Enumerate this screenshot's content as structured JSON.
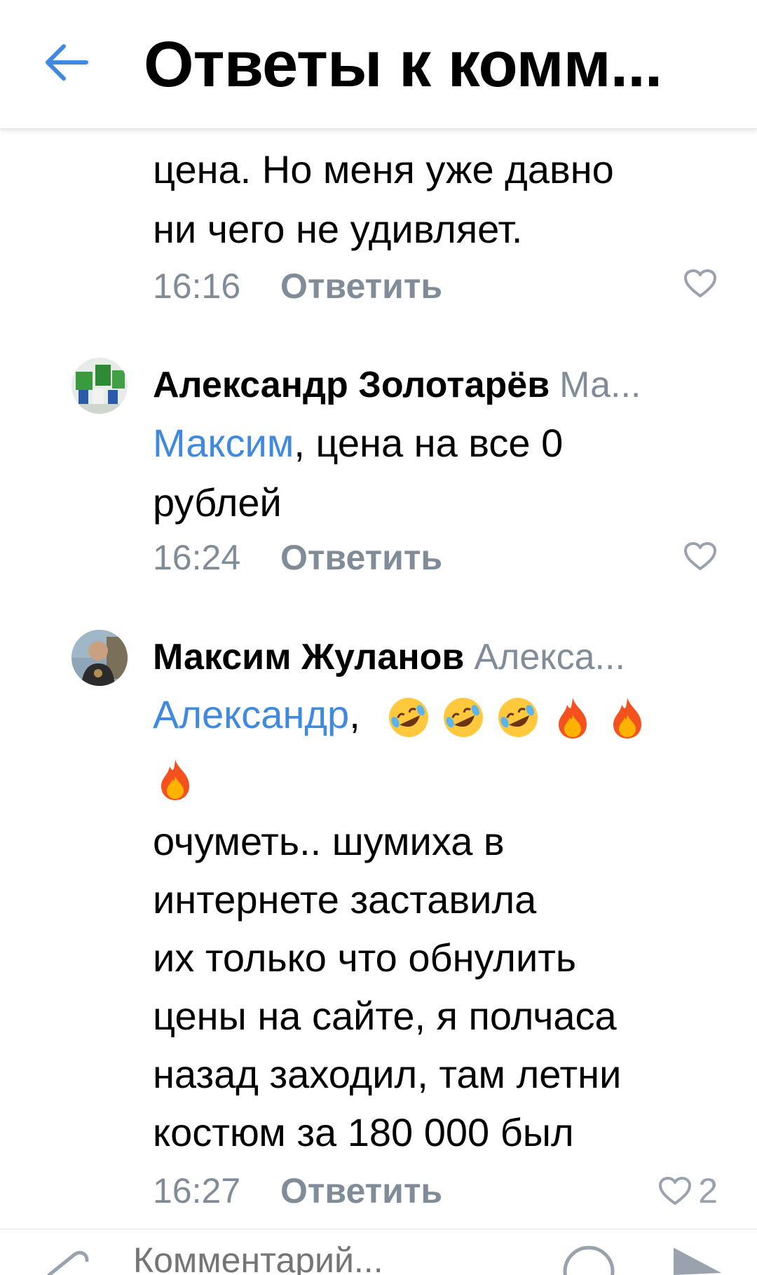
{
  "header": {
    "title": "Ответы к комм..."
  },
  "comments": [
    {
      "text_lines": [
        "цена. Но меня уже давно",
        "ни чего не удивляет."
      ],
      "time": "16:16",
      "reply_label": "Ответить"
    },
    {
      "author": "Александр Золотарёв",
      "reply_to": "Ма...",
      "mention": "Максим",
      "text_after_mention": ", цена на все 0",
      "text_lines": [
        "рублей"
      ],
      "time": "16:24",
      "reply_label": "Ответить"
    },
    {
      "author": "Максим Жуланов",
      "reply_to": "Алекса...",
      "mention": "Александр",
      "text_after_mention": ",",
      "emojis": [
        "rolling-laughing-emoji",
        "rolling-laughing-emoji",
        "rolling-laughing-emoji",
        "fire-emoji",
        "fire-emoji",
        "fire-emoji"
      ],
      "text_lines": [
        "очуметь.. шумиха в",
        "интернете заставила",
        "их только что обнулить",
        "цены на сайте, я полчаса",
        "назад заходил, там летни",
        "костюм за 180 000 был"
      ],
      "time": "16:27",
      "reply_label": "Ответить",
      "likes": "2"
    }
  ],
  "composer": {
    "placeholder": "Комментарий..."
  },
  "colors": {
    "accent": "#3f8ae0",
    "secondary_text": "#818c99",
    "icon": "#99a2ad"
  }
}
